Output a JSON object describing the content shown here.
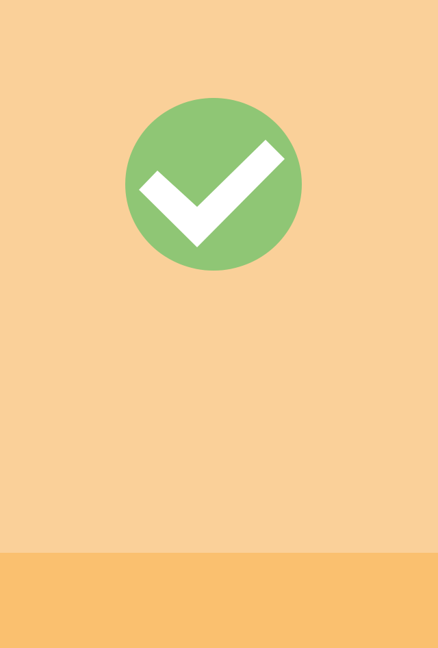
{
  "theme": {
    "background": "#FAD099",
    "bottom_bar": "#FAC06F",
    "success_green": "#8FC675",
    "check_color": "#FFFFFF"
  },
  "icons": {
    "status": "checkmark-success-icon"
  }
}
